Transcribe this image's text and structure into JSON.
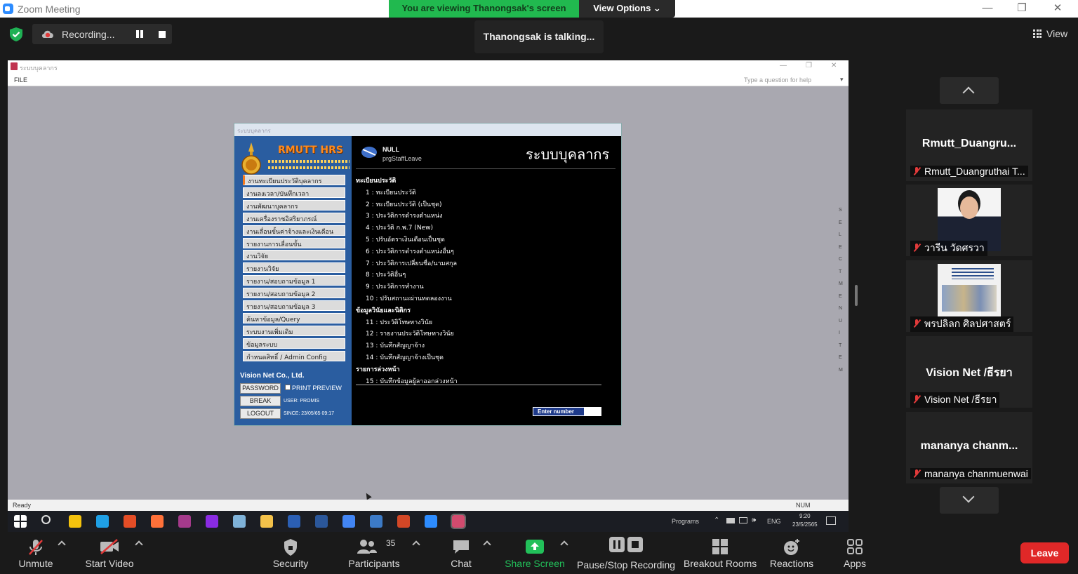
{
  "window": {
    "title": "Zoom Meeting",
    "minimize": "—",
    "maximize": "❐",
    "close": "✕"
  },
  "share_banner": {
    "text": "You are viewing Thanongsak's screen",
    "view_options": "View Options ⌄"
  },
  "recording": {
    "label": "Recording..."
  },
  "talking": {
    "text": "Thanongsak is talking..."
  },
  "view_button": {
    "label": "View"
  },
  "shared_app": {
    "title": "ระบบบุคลากร",
    "menu_file": "FILE",
    "help_box": "Type a question for help",
    "status_left": "Ready",
    "status_right": "NUM",
    "form_title": "ระบบบุคลากร",
    "logo_title": "RMUTT HRS",
    "left_menu": [
      "งานทะเบียนประวัติบุคลากร",
      "งานลงเวลา/บันทึกเวลา",
      "งานพัฒนาบุคลากร",
      "งานเครื่องราชอิสริยาภรณ์",
      "งานเลื่อนขั้นค่าจ้างและเงินเดือน",
      "รายงานการเลื่อนขั้น",
      "งานวิจัย",
      "รายงานวิจัย",
      "รายงาน/สอบถามข้อมูล 1",
      "รายงาน/สอบถามข้อมูล 2",
      "รายงาน/สอบถามข้อมูล 3",
      "ค้นหาข้อมูล/Query",
      "ระบบงานเพิ่มเติม",
      "ข้อมูลระบบ",
      "กำหนดสิทธิ์ / Admin Config"
    ],
    "company": "Vision Net Co., Ltd.",
    "btn_password": "PASSWORD",
    "print_preview": "PRINT PREVIEW",
    "btn_break": "BREAK",
    "user_info": "USER: PROMIS",
    "btn_logout": "LOGOUT",
    "since_info": "SINCE: 23/05/65 09:17",
    "null_text": "NULL",
    "prg_text": "prgStaffLeave",
    "main_title": "ระบบบุคลากร",
    "sections": [
      {
        "title": "ทะเบียนประวัติ",
        "items": [
          "1 : ทะเบียนประวัติ",
          "2 : ทะเบียนประวัติ (เป็นชุด)",
          "3 : ประวัติการดำรงตำแหน่ง",
          "4 : ประวัติ ก.พ.7 (New)",
          "5 : ปรับอัตราเงินเดือนเป็นชุด",
          "6 : ประวัติการดำรงตำแหน่งอื่นๆ",
          "7 : ประวัติการเปลี่ยนชื่อ/นามสกุล",
          "8 : ประวัติอื่นๆ",
          "9 : ประวัติการทำงาน",
          "10 : ปรับสถานะผ่านทดลองงาน"
        ]
      },
      {
        "title": "ข้อมูลวินัยและนิติกร",
        "items": [
          "11 : ประวัติโทษทางวินัย",
          "12 : รายงานประวัติโทษทางวินัย",
          "13 : บันทึกสัญญาจ้าง",
          "14 : บันทึกสัญญาจ้างเป็นชุด"
        ]
      },
      {
        "title": "รายการล่วงหน้า",
        "items": [
          "15 : บันทึกข้อมูลผู้ลาออกล่วงหน้า"
        ]
      }
    ],
    "vertical_text": "SELECT MENU ITEM",
    "enter_number": "Enter number"
  },
  "taskbar": {
    "programs": "Programs",
    "lang": "ENG",
    "time": "9:20",
    "date": "23/5/2565",
    "icons": [
      "windows-icon",
      "search-icon",
      "sticky-notes-icon",
      "edge-icon",
      "slides-icon",
      "firefox-icon",
      "app-icon",
      "visual-studio-icon",
      "app2-icon",
      "file-explorer-icon",
      "app3-icon",
      "word-icon",
      "chrome-icon",
      "acrobat-icon",
      "powerpoint-icon",
      "zoom-icon",
      "access-icon"
    ],
    "icon_colors": [
      "#ffffff",
      "#dddddd",
      "#f4c20d",
      "#1fa0e6",
      "#e44d26",
      "#ff7139",
      "#a43a8b",
      "#8a2be2",
      "#7fb2d8",
      "#f3c14a",
      "#2b5fb4",
      "#2b579a",
      "#4285f4",
      "#3c7ac6",
      "#d24726",
      "#2d8cff",
      "#d14b6e"
    ]
  },
  "participants": [
    {
      "name": "Rmutt_Duangru...",
      "label": "Rmutt_Duangruthai T...",
      "type": "name"
    },
    {
      "name": "",
      "label": "วารีน วัดศรวา",
      "type": "photo-person"
    },
    {
      "name": "",
      "label": "พรปลิลก ศิลปศาสตร์",
      "type": "photo-slide"
    },
    {
      "name": "Vision Net /ธีรยา",
      "label": "Vision Net /ธีรยา",
      "type": "name"
    },
    {
      "name": "mananya chanm...",
      "label": "mananya chanmuenwai",
      "type": "name"
    }
  ],
  "toolbar": {
    "unmute": "Unmute",
    "start_video": "Start Video",
    "security": "Security",
    "participants": "Participants",
    "participants_count": "35",
    "chat": "Chat",
    "share_screen": "Share Screen",
    "pause_stop": "Pause/Stop Recording",
    "breakout": "Breakout Rooms",
    "reactions": "Reactions",
    "apps": "Apps",
    "leave": "Leave"
  },
  "colors": {
    "share_green": "#21b94f",
    "leave_red": "#e02828",
    "muted_red": "#e23a3a",
    "form_blue": "#2a5da0",
    "logo_orange": "#ff8a1c"
  }
}
